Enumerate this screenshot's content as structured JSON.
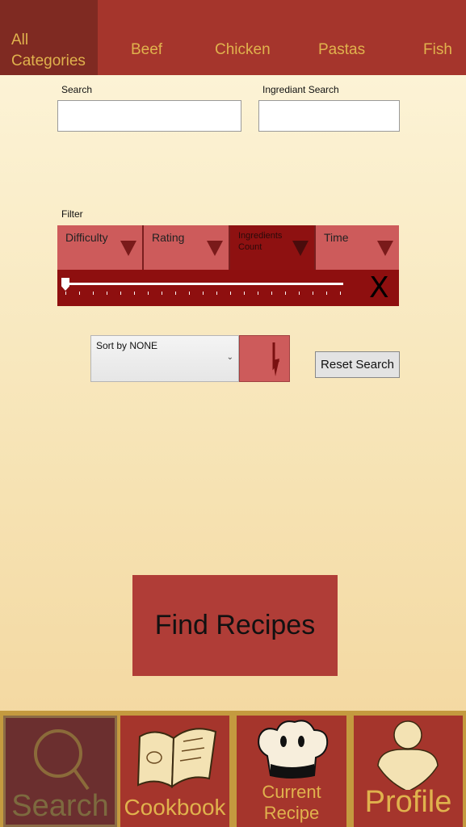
{
  "topnav": {
    "tabs": [
      {
        "label_line1": "All",
        "label_line2": "Categories"
      },
      {
        "label": "Beef"
      },
      {
        "label": "Chicken"
      },
      {
        "label": "Pastas"
      },
      {
        "label": "Fish"
      }
    ]
  },
  "search": {
    "label": "Search",
    "value": "",
    "ingredient_label": "Ingrediant Search",
    "ingredient_value": ""
  },
  "filter": {
    "label": "Filter",
    "options": [
      {
        "label": "Difficulty"
      },
      {
        "label": "Rating"
      },
      {
        "label": "Ingredients Count"
      },
      {
        "label": "Time"
      }
    ],
    "selected_index": 2,
    "slider_value": 0,
    "clear_label": "X"
  },
  "sort": {
    "selected": "Sort by NONE",
    "reset_label": "Reset Search"
  },
  "actions": {
    "find_label": "Find Recipes"
  },
  "bottomnav": {
    "items": [
      {
        "label": "Search",
        "icon": "search-icon"
      },
      {
        "label": "Cookbook",
        "icon": "book-icon"
      },
      {
        "label_line1": "Current",
        "label_line2": "Recipe",
        "icon": "chef-hat-icon"
      },
      {
        "label": "Profile",
        "icon": "person-icon"
      }
    ],
    "selected_index": 0
  },
  "colors": {
    "header": "#a5352c",
    "header_selected": "#7f2a22",
    "tab_text": "#e0b24d",
    "filter_cell": "#cd5b5b",
    "filter_active": "#8e1111",
    "find_button": "#b03d37",
    "bottom_border": "#c49a3f"
  }
}
